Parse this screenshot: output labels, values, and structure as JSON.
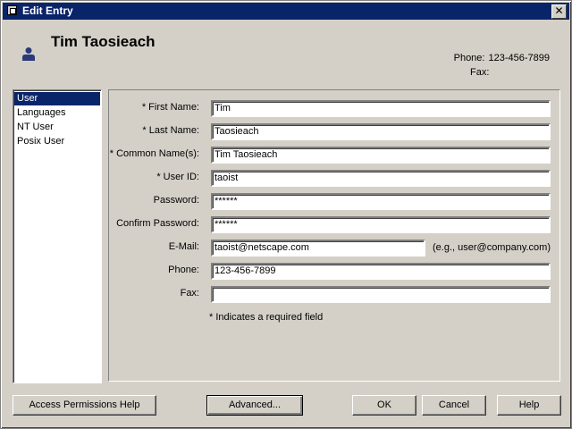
{
  "window": {
    "title": "Edit Entry",
    "close_glyph": "✕"
  },
  "header": {
    "name": "Tim Taosieach",
    "phone_label": "Phone:",
    "phone_value": "123-456-7899",
    "fax_label": "Fax:",
    "fax_value": "",
    "icon": "user-icon"
  },
  "nav": {
    "items": [
      {
        "label": "User",
        "selected": true
      },
      {
        "label": "Languages",
        "selected": false
      },
      {
        "label": "NT User",
        "selected": false
      },
      {
        "label": "Posix User",
        "selected": false
      }
    ]
  },
  "form": {
    "first_name_label": "* First Name:",
    "first_name_value": "Tim",
    "last_name_label": "* Last Name:",
    "last_name_value": "Taosieach",
    "common_name_label": "* Common Name(s):",
    "common_name_value": "Tim Taosieach",
    "user_id_label": "* User ID:",
    "user_id_value": "taoist",
    "password_label": "Password:",
    "password_value": "******",
    "confirm_password_label": "Confirm Password:",
    "confirm_password_value": "******",
    "email_label": "E-Mail:",
    "email_value": "taoist@netscape.com",
    "email_hint": "(e.g., user@company.com)",
    "phone_label": "Phone:",
    "phone_value": "123-456-7899",
    "fax_label": "Fax:",
    "fax_value": "",
    "required_note": "* Indicates a required field"
  },
  "buttons": {
    "help_permissions": "Access Permissions Help",
    "advanced": "Advanced...",
    "ok": "OK",
    "cancel": "Cancel",
    "help": "Help"
  },
  "colors": {
    "titlebar": "#0a246a",
    "selection": "#0a246a",
    "face": "#d4d0c8",
    "user_icon": "#2b3a78"
  }
}
